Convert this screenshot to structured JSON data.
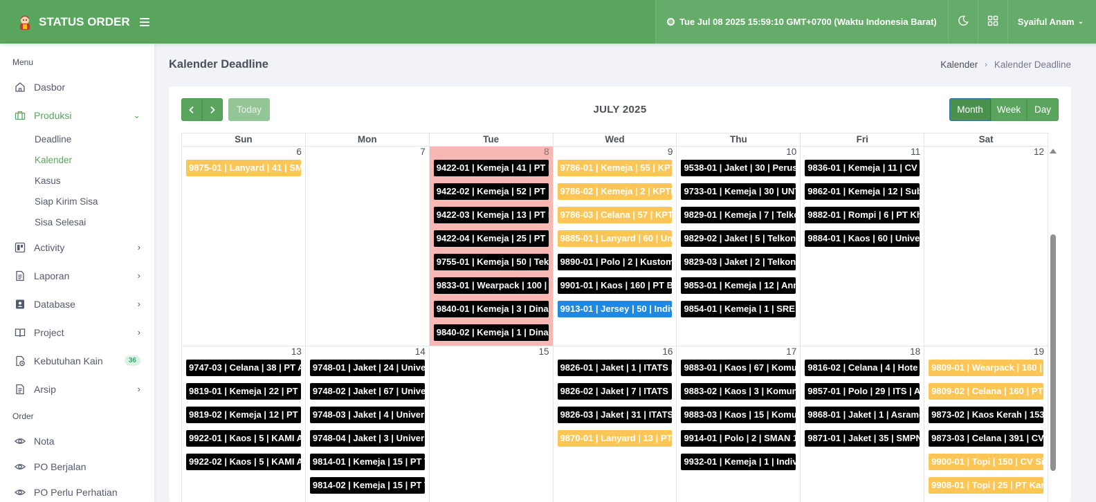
{
  "header": {
    "app_title": "STATUS ORDER",
    "clock": "Tue Jul 08 2025 15:59:10 GMT+0700 (Waktu Indonesia Barat)",
    "user_name": "Syaiful Anam",
    "icons": [
      "logo-icon",
      "hamburger-icon",
      "clock-icon",
      "moon-icon",
      "grid-icon",
      "chevron-down-icon"
    ]
  },
  "sidebar": {
    "section_menu": "Menu",
    "dasbor": "Dasbor",
    "produksi": "Produksi",
    "produksi_sub": [
      "Deadline",
      "Kalender",
      "Kasus",
      "Siap Kirim Sisa",
      "Sisa Selesai"
    ],
    "activity": "Activity",
    "laporan": "Laporan",
    "database": "Database",
    "project": "Project",
    "kebutuhan_kain": "Kebutuhan Kain",
    "kebutuhan_kain_badge": "36",
    "arsip": "Arsip",
    "section_order": "Order",
    "nota": "Nota",
    "po_berjalan": "PO Berjalan",
    "po_perlu": "PO Perlu Perhatian"
  },
  "page": {
    "title": "Kalender Deadline",
    "breadcrumb_parent": "Kalender",
    "breadcrumb_current": "Kalender Deadline"
  },
  "calendar": {
    "title": "JULY 2025",
    "today_label": "Today",
    "view_month": "Month",
    "view_week": "Week",
    "view_day": "Day",
    "days": [
      "Sun",
      "Mon",
      "Tue",
      "Wed",
      "Thu",
      "Fri",
      "Sat"
    ],
    "weeks": [
      [
        {
          "num": "6",
          "events": [
            {
              "t": "9875-01 | Lanyard | 41 | SMI",
              "c": "yellow"
            }
          ]
        },
        {
          "num": "7",
          "events": []
        },
        {
          "num": "8",
          "today": true,
          "events": [
            {
              "t": "9422-01 | Kemeja | 41 | PT K",
              "c": "black"
            },
            {
              "t": "9422-02 | Kemeja | 52 | PT",
              "c": "black"
            },
            {
              "t": "9422-03 | Kemeja | 13 | PT I",
              "c": "black"
            },
            {
              "t": "9422-04 | Kemeja | 25 | PT",
              "c": "black"
            },
            {
              "t": "9755-01 | Kemeja | 50 | Tek",
              "c": "black"
            },
            {
              "t": "9833-01 | Wearpack | 100 |",
              "c": "black"
            },
            {
              "t": "9840-01 | Kemeja | 3 | Dina",
              "c": "black"
            },
            {
              "t": "9840-02 | Kemeja | 1 | Dina",
              "c": "black"
            }
          ]
        },
        {
          "num": "9",
          "events": [
            {
              "t": "9786-01 | Kemeja | 55 | KPT",
              "c": "yellow"
            },
            {
              "t": "9786-02 | Kemeja | 2 | KPTI",
              "c": "yellow"
            },
            {
              "t": "9786-03 | Celana | 57 | KPT",
              "c": "yellow"
            },
            {
              "t": "9885-01 | Lanyard | 60 | Un",
              "c": "yellow"
            },
            {
              "t": "9890-01 | Polo | 2 | Kustom",
              "c": "black"
            },
            {
              "t": "9901-01 | Kaos | 160 | PT Be",
              "c": "black"
            },
            {
              "t": "9913-01 | Jersey | 50 | Indiv",
              "c": "blue"
            }
          ]
        },
        {
          "num": "10",
          "events": [
            {
              "t": "9538-01 | Jaket | 30 | Perus",
              "c": "black"
            },
            {
              "t": "9733-01 | Kemeja | 30 | UNT",
              "c": "black"
            },
            {
              "t": "9829-01 | Kemeja | 7 | Telkc",
              "c": "black"
            },
            {
              "t": "9829-02 | Jaket | 5 | Telkon",
              "c": "black"
            },
            {
              "t": "9829-03 | Jaket | 2 | Telkon",
              "c": "black"
            },
            {
              "t": "9853-01 | Kemeja | 12 | Ann",
              "c": "black"
            },
            {
              "t": "9854-01 | Kemeja | 1 | SRE L",
              "c": "black"
            }
          ]
        },
        {
          "num": "11",
          "events": [
            {
              "t": "9836-01 | Kemeja | 11 | CV L",
              "c": "black"
            },
            {
              "t": "9862-01 | Kemeja | 12 | Sub",
              "c": "black"
            },
            {
              "t": "9882-01 | Rompi | 6 | PT Kh",
              "c": "black"
            },
            {
              "t": "9884-01 | Kaos | 60 | Unive",
              "c": "black"
            }
          ]
        },
        {
          "num": "12",
          "events": []
        }
      ],
      [
        {
          "num": "13",
          "events": [
            {
              "t": "9747-03 | Celana | 38 | PT A",
              "c": "black"
            },
            {
              "t": "9819-01 | Kemeja | 22 | PT S",
              "c": "black"
            },
            {
              "t": "9819-02 | Kemeja | 12 | PT S",
              "c": "black"
            },
            {
              "t": "9922-01 | Kaos | 5 | KAMI A",
              "c": "black"
            },
            {
              "t": "9922-02 | Kaos | 5 | KAMI A",
              "c": "black"
            }
          ]
        },
        {
          "num": "14",
          "events": [
            {
              "t": "9748-01 | Jaket | 24 | Unive",
              "c": "black"
            },
            {
              "t": "9748-02 | Jaket | 67 | Unive",
              "c": "black"
            },
            {
              "t": "9748-03 | Jaket | 4 | Univer",
              "c": "black"
            },
            {
              "t": "9748-04 | Jaket | 3 | Univer",
              "c": "black"
            },
            {
              "t": "9814-01 | Kemeja | 15 | PT T",
              "c": "black"
            },
            {
              "t": "9814-02 | Kemeja | 15 | PT T",
              "c": "black"
            }
          ]
        },
        {
          "num": "15",
          "events": []
        },
        {
          "num": "16",
          "events": [
            {
              "t": "9826-01 | Jaket | 1 | ITATS |",
              "c": "black"
            },
            {
              "t": "9826-02 | Jaket | 7 | ITATS",
              "c": "black"
            },
            {
              "t": "9826-03 | Jaket | 31 | ITATS",
              "c": "black"
            },
            {
              "t": "9870-01 | Lanyard | 13 | PT I",
              "c": "yellow"
            }
          ]
        },
        {
          "num": "17",
          "events": [
            {
              "t": "9883-01 | Kaos | 67 | Komur",
              "c": "black"
            },
            {
              "t": "9883-02 | Kaos | 3 | Komun",
              "c": "black"
            },
            {
              "t": "9883-03 | Kaos | 15 | Komur",
              "c": "black"
            },
            {
              "t": "9914-01 | Polo | 2 | SMAN 1 I",
              "c": "black"
            },
            {
              "t": "9932-01 | Kemeja | 1 | Indivi",
              "c": "black"
            }
          ]
        },
        {
          "num": "18",
          "events": [
            {
              "t": "9816-02 | Celana | 4 | Hote",
              "c": "black"
            },
            {
              "t": "9857-01 | Polo | 29 | ITS | A",
              "c": "black"
            },
            {
              "t": "9868-01 | Jaket | 1 | Asramc",
              "c": "black"
            },
            {
              "t": "9871-01 | Jaket | 35 | SMPN",
              "c": "black"
            }
          ]
        },
        {
          "num": "19",
          "events": [
            {
              "t": "9809-01 | Wearpack | 160 |",
              "c": "yellow"
            },
            {
              "t": "9809-02 | Celana | 160 | PT",
              "c": "yellow"
            },
            {
              "t": "9873-02 | Kaos Kerah | 153",
              "c": "black"
            },
            {
              "t": "9873-03 | Celana | 391 | CV",
              "c": "black"
            },
            {
              "t": "9900-01 | Topi | 150 | CV Si",
              "c": "yellow"
            },
            {
              "t": "9908-01 | Topi | 25 | PT Kar",
              "c": "yellow"
            }
          ]
        }
      ]
    ]
  },
  "colors": {
    "primary_green": "#5aa55e",
    "today_bg": "#f7b8b4",
    "event_black": "#000000",
    "event_yellow": "#fcc656",
    "event_blue": "#1e88e5"
  }
}
